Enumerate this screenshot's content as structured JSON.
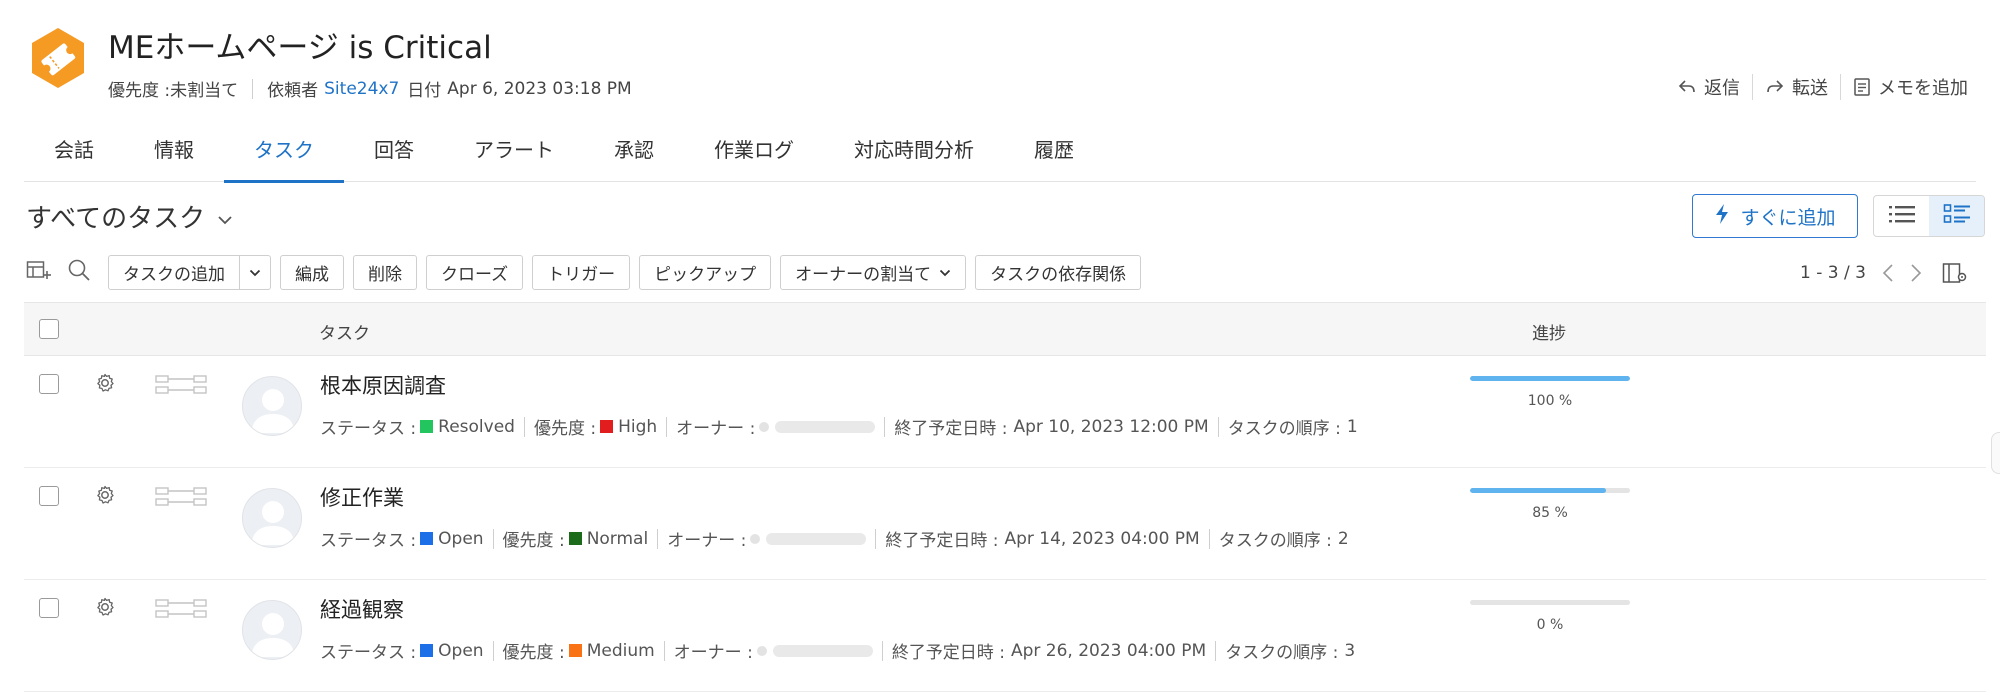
{
  "header": {
    "title": "MEホームページ is Critical",
    "priority_label": "優先度 :",
    "priority_value": "未割当て",
    "requester_label": "依頼者",
    "requester_value": "Site24x7",
    "date_label": "日付",
    "date_value": "Apr 6, 2023 03:18 PM",
    "logo_icon": "ticket-icon",
    "logo_color": "#f59a23"
  },
  "actions": [
    {
      "label": "返信",
      "icon": "reply-icon"
    },
    {
      "label": "転送",
      "icon": "forward-icon"
    },
    {
      "label": "メモを追加",
      "icon": "note-icon"
    }
  ],
  "tabs": [
    {
      "label": "会話"
    },
    {
      "label": "情報"
    },
    {
      "label": "タスク",
      "active": true
    },
    {
      "label": "回答"
    },
    {
      "label": "アラート"
    },
    {
      "label": "承認"
    },
    {
      "label": "作業ログ"
    },
    {
      "label": "対応時間分析"
    },
    {
      "label": "履歴"
    }
  ],
  "view": {
    "title": "すべてのタスク",
    "quick_add_label": "すぐに追加"
  },
  "toolbar": {
    "add_task": "タスクの追加",
    "edit": "編成",
    "delete": "削除",
    "close": "クローズ",
    "trigger": "トリガー",
    "pickup": "ピックアップ",
    "assign_owner": "オーナーの割当て",
    "dependencies": "タスクの依存関係"
  },
  "pager": {
    "range": "1 - 3 / 3"
  },
  "table": {
    "col_task": "タスク",
    "col_progress": "進捗"
  },
  "labels": {
    "status": "ステータス :",
    "priority": "優先度 :",
    "owner": "オーナー :",
    "due": "終了予定日時 :",
    "order": "タスクの順序 :"
  },
  "tasks": [
    {
      "name": "根本原因調査",
      "status": "Resolved",
      "status_color": "#22c55e",
      "priority": "High",
      "priority_color": "#e11d1d",
      "due": "Apr 10, 2023 12:00 PM",
      "order": "1",
      "progress_text": "100 %",
      "progress": 100
    },
    {
      "name": "修正作業",
      "status": "Open",
      "status_color": "#1d6fe8",
      "priority": "Normal",
      "priority_color": "#1b6b1b",
      "due": "Apr 14, 2023 04:00 PM",
      "order": "2",
      "progress_text": "85 %",
      "progress": 85
    },
    {
      "name": "経過観察",
      "status": "Open",
      "status_color": "#1d6fe8",
      "priority": "Medium",
      "priority_color": "#f97316",
      "due": "Apr 26, 2023 04:00 PM",
      "order": "3",
      "progress_text": "0 %",
      "progress": 0
    }
  ]
}
